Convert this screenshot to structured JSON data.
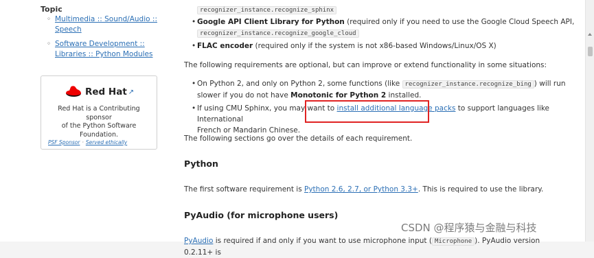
{
  "sidebar": {
    "topic_title": "Topic",
    "topics": [
      {
        "line1": "Multimedia :: Sound/Audio ::",
        "line2": "Speech"
      },
      {
        "line1": "Software Development ::",
        "line2": "Libraries :: Python Modules"
      }
    ],
    "sponsor": {
      "logo_text": "Red Hat",
      "description_line1": "Red Hat is a Contributing sponsor",
      "description_line2": "of the Python Software",
      "description_line3": "Foundation.",
      "link_psf": "PSF Sponsor",
      "link_separator": "·",
      "link_served": "Served ethically"
    }
  },
  "main": {
    "top_code": "recognizer_instance.recognize_sphinx",
    "google_bold": "Google API Client Library for Python",
    "google_text": " (required only if you need to use the Google Cloud Speech API,",
    "google_code": "recognizer_instance.recognize_google_cloud",
    "flac_bold": "FLAC encoder",
    "flac_text": " (required only if the system is not x86-based Windows/Linux/OS X)",
    "optional_intro": "The following requirements are optional, but can improve or extend functionality in some situations:",
    "py2_text1": "On Python 2, and only on Python 2, some functions (like ",
    "py2_code": "recognizer_instance.recognize_bing",
    "py2_text2": ") will run",
    "py2_text3": "slower if you do not have ",
    "py2_bold": "Monotonic for Python 2",
    "py2_text4": " installed.",
    "sphinx_text1": "If using CMU Sphinx, you may want to ",
    "sphinx_link": "install additional language packs",
    "sphinx_text2": " to support languages like International",
    "sphinx_text3": "French or Mandarin Chinese.",
    "details_intro": "The following sections go over the details of each requirement.",
    "python_heading": "Python",
    "python_text1": "The first software requirement is ",
    "python_link": "Python 2.6, 2.7, or Python 3.3+",
    "python_text2": ". This is required to use the library.",
    "pyaudio_heading": "PyAudio (for microphone users)",
    "pyaudio_link": "PyAudio",
    "pyaudio_text1": " is required if and only if you want to use microphone input (",
    "pyaudio_code": "Microphone",
    "pyaudio_text2": "). PyAudio version 0.2.11+ is"
  },
  "colors": {
    "link": "#2b6fb5",
    "highlight": "#e02222",
    "redhat": "#ee0000"
  },
  "watermark": "CSDN @程序猿与金融与科技"
}
